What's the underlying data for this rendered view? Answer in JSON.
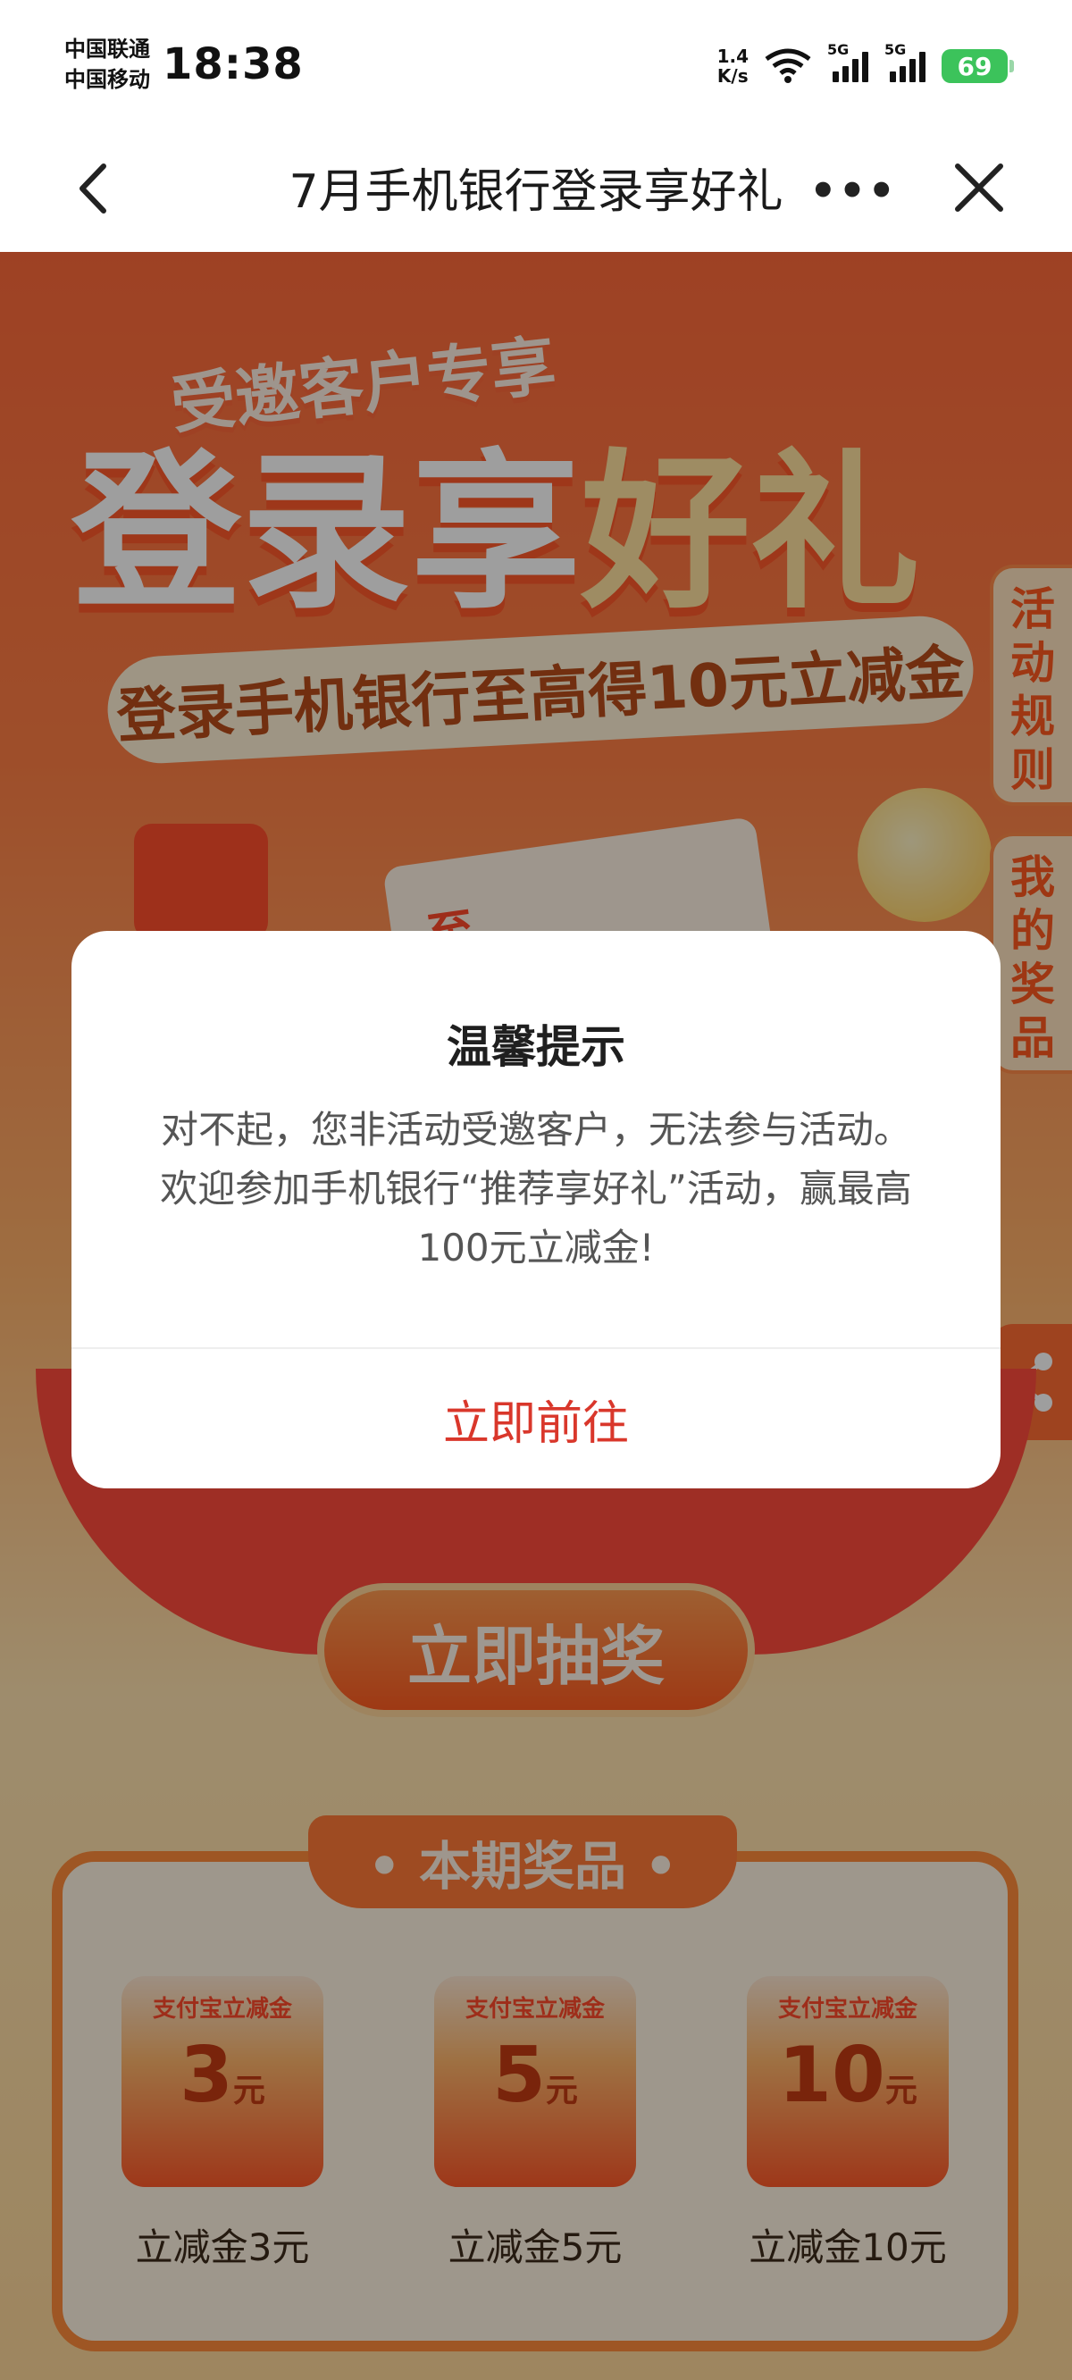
{
  "status_bar": {
    "carrier_1": "中国联通",
    "carrier_2": "中国移动",
    "time": "18:38",
    "net_speed_value": "1.4",
    "net_speed_unit": "K/s",
    "signal_tag_1": "5G",
    "signal_tag_2": "5G",
    "battery": "69"
  },
  "nav": {
    "title": "7月手机银行登录享好礼",
    "more": "•••"
  },
  "hero": {
    "subtitle": "受邀客户专享",
    "title_part1": "登录享",
    "title_part2": "好礼",
    "banner": "登录手机银行至高得10元立减金",
    "ticket_text": "至"
  },
  "side_tabs": {
    "rules": "活动规则",
    "my_prizes": "我的奖品"
  },
  "lottery_button": "立即抽奖",
  "prizes": {
    "title": "• 本期奖品 •",
    "items": [
      {
        "brand": "支付宝立减金",
        "amount": "3",
        "unit": "元",
        "name": "立减金3元"
      },
      {
        "brand": "支付宝立减金",
        "amount": "5",
        "unit": "元",
        "name": "立减金5元"
      },
      {
        "brand": "支付宝立减金",
        "amount": "10",
        "unit": "元",
        "name": "立减金10元"
      }
    ]
  },
  "dialog": {
    "title": "温馨提示",
    "message": "对不起，您非活动受邀客户，无法参与活动。欢迎参加手机银行“推荐享好礼”活动，赢最高100元立减金!",
    "action": "立即前往"
  },
  "colors": {
    "accent_red": "#d9372b",
    "battery_green": "#3cc35b",
    "page_orange": "#ff7f45"
  }
}
